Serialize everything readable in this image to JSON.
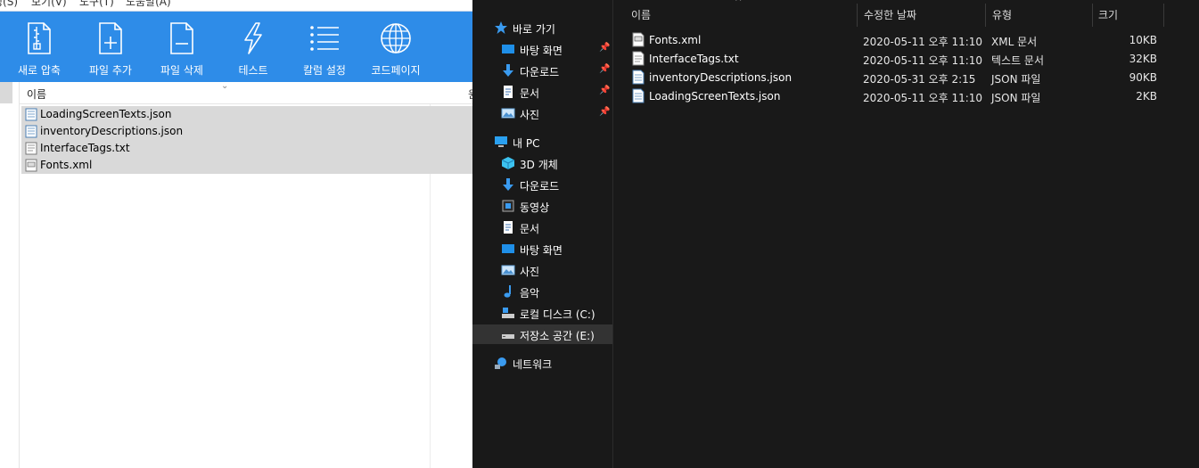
{
  "zip_app": {
    "menu": [
      "정(S)",
      "보기(V)",
      "도구(T)",
      "도움말(A)"
    ],
    "toolbar": [
      {
        "label": "새로 압축",
        "icon": "new-archive-icon"
      },
      {
        "label": "파일 추가",
        "icon": "add-file-icon"
      },
      {
        "label": "파일 삭제",
        "icon": "delete-file-icon"
      },
      {
        "label": "테스트",
        "icon": "test-lightning-icon"
      },
      {
        "label": "칼럼 설정",
        "icon": "column-settings-icon"
      },
      {
        "label": "코드페이지",
        "icon": "codepage-globe-icon"
      }
    ],
    "colors": {
      "ribbon": "#2e8ce8",
      "row_selected": "#d9d9d9"
    },
    "list": {
      "header_name": "이름",
      "header_second": "원",
      "files": [
        {
          "name": "LoadingScreenTexts.json",
          "icon": "json-file-icon"
        },
        {
          "name": "inventoryDescriptions.json",
          "icon": "json-file-icon"
        },
        {
          "name": "InterfaceTags.txt",
          "icon": "text-file-icon"
        },
        {
          "name": "Fonts.xml",
          "icon": "xml-file-icon"
        }
      ]
    }
  },
  "explorer": {
    "colors": {
      "background": "#191919",
      "selected": "#333333"
    },
    "nav": {
      "quick_access": "바로 가기",
      "quick_items": [
        "바탕 화면",
        "다운로드",
        "문서",
        "사진"
      ],
      "this_pc": "내 PC",
      "pc_items": [
        "3D 개체",
        "다운로드",
        "동영상",
        "문서",
        "바탕 화면",
        "사진",
        "음악",
        "로컬 디스크 (C:)",
        "저장소 공간 (E:)"
      ],
      "network": "네트워크"
    },
    "columns": {
      "name": "이름",
      "modified": "수정한 날짜",
      "type": "유형",
      "size": "크기"
    },
    "files": [
      {
        "name": "Fonts.xml",
        "modified": "2020-05-11 오후 11:10",
        "type": "XML 문서",
        "size": "10KB",
        "icon": "xml-file-icon"
      },
      {
        "name": "InterfaceTags.txt",
        "modified": "2020-05-11 오후 11:10",
        "type": "텍스트 문서",
        "size": "32KB",
        "icon": "text-file-icon"
      },
      {
        "name": "inventoryDescriptions.json",
        "modified": "2020-05-31 오후 2:15",
        "type": "JSON 파일",
        "size": "90KB",
        "icon": "json-file-icon"
      },
      {
        "name": "LoadingScreenTexts.json",
        "modified": "2020-05-11 오후 11:10",
        "type": "JSON 파일",
        "size": "2KB",
        "icon": "json-file-icon"
      }
    ]
  }
}
